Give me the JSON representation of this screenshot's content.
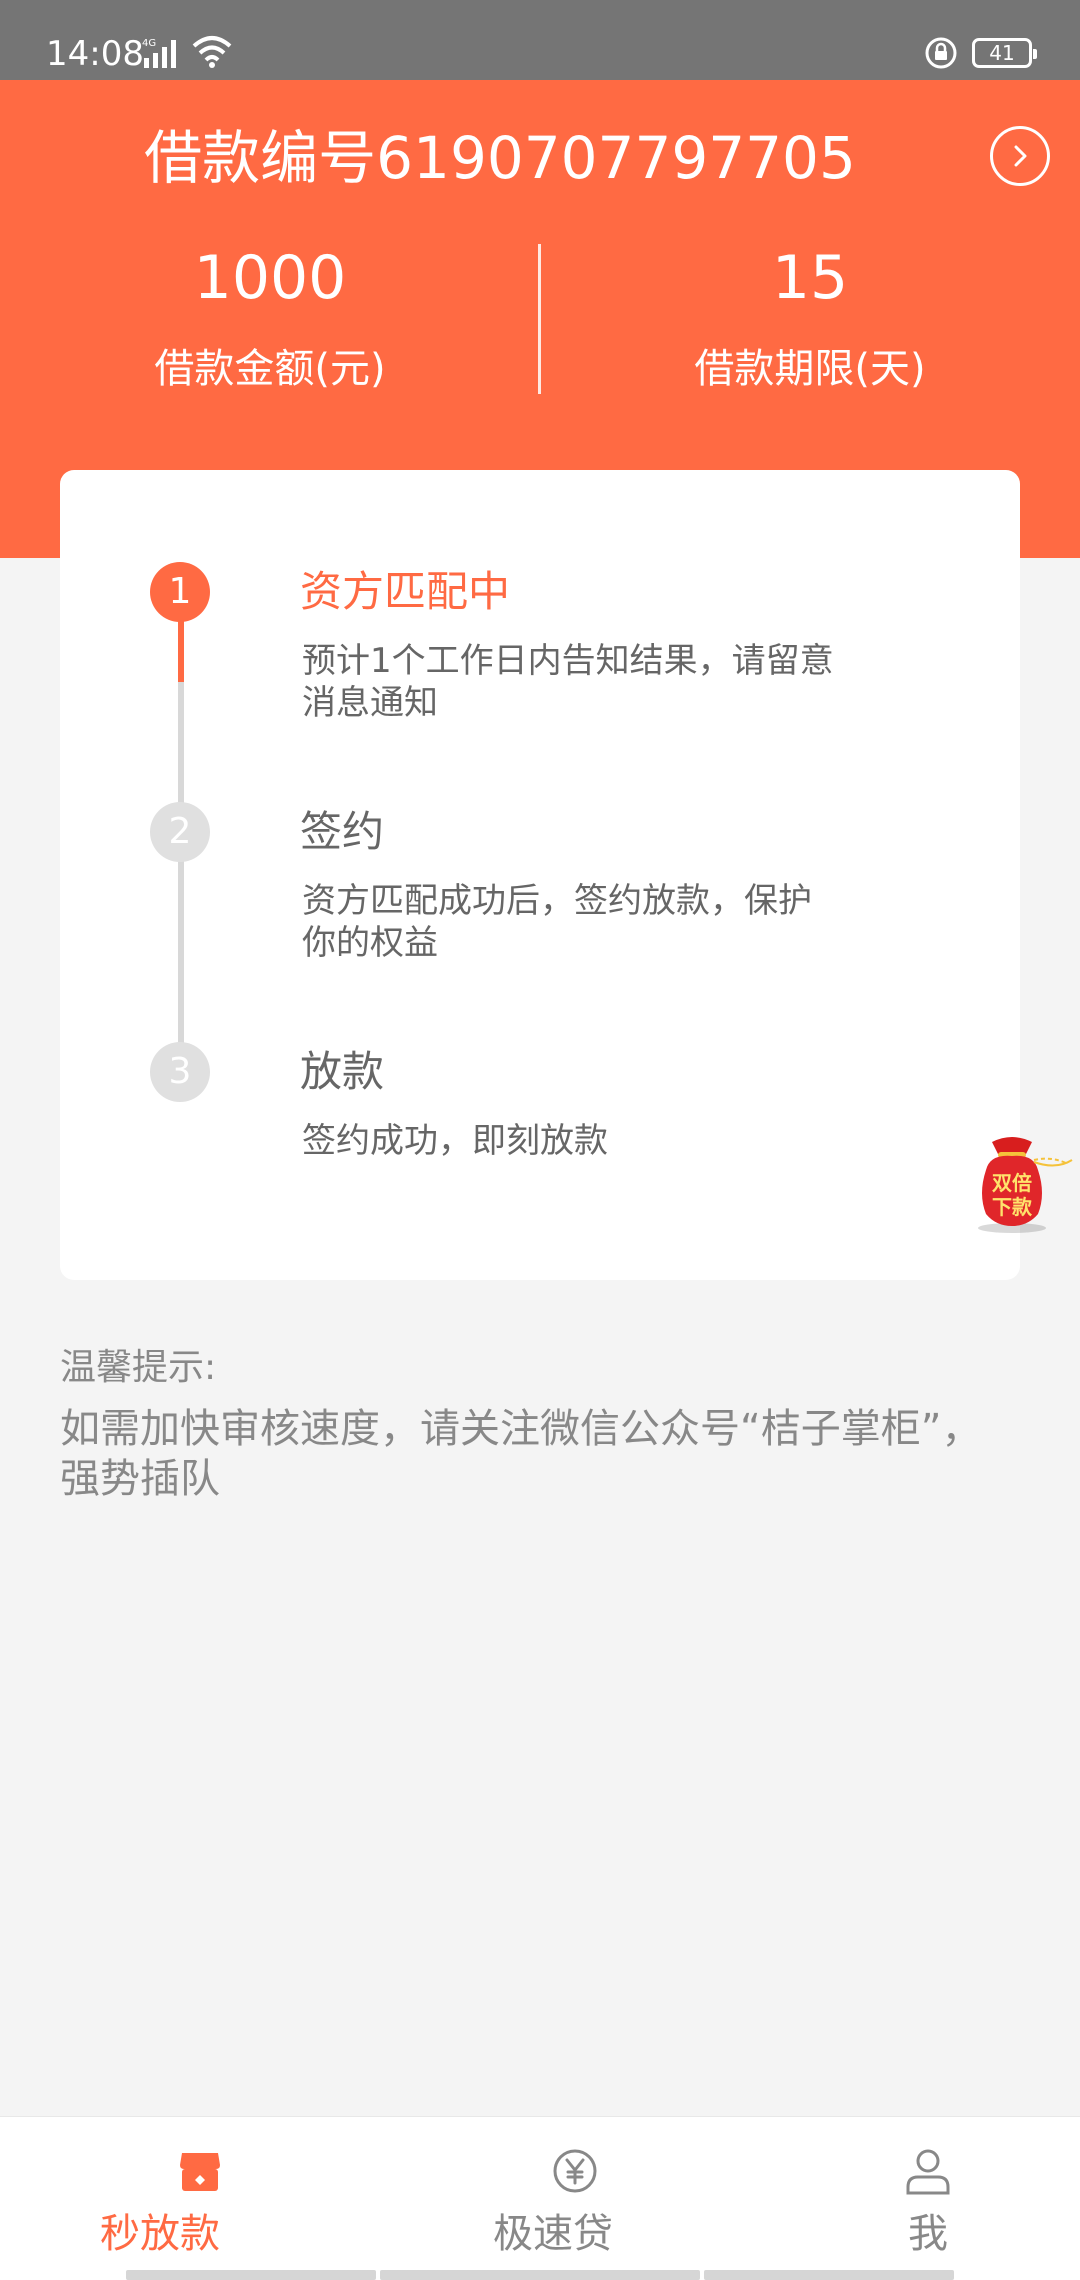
{
  "status_bar": {
    "time": "14:08",
    "network": "4G",
    "battery": "41"
  },
  "header": {
    "loan_title": "借款编号6190707797705",
    "amount_value": "1000",
    "amount_label": "借款金额(元)",
    "term_value": "15",
    "term_label": "借款期限(天)"
  },
  "progress": {
    "current_step": 1,
    "steps": [
      {
        "number": "1",
        "title": "资方匹配中",
        "desc": "预计1个工作日内告知结果，请留意消息通知"
      },
      {
        "number": "2",
        "title": "签约",
        "desc": "资方匹配成功后，签约放款，保护你的权益"
      },
      {
        "number": "3",
        "title": "放款",
        "desc": "签约成功，即刻放款"
      }
    ]
  },
  "floating_bag": {
    "text_line1": "双倍",
    "text_line2": "下款"
  },
  "tips": {
    "title": "温馨提示:",
    "text": "如需加快审核速度，请关注微信公众号“桔子掌柜”，强势插队"
  },
  "tabbar": {
    "items": [
      {
        "label": "秒放款",
        "icon": "shop-icon",
        "active": true
      },
      {
        "label": "极速贷",
        "icon": "yen-coin-icon",
        "active": false
      },
      {
        "label": "我",
        "icon": "user-icon",
        "active": false
      }
    ]
  },
  "colors": {
    "accent": "#ff6a43",
    "status_bar": "#757575",
    "inactive_step": "#e0e0e0",
    "background": "#f4f4f4"
  }
}
